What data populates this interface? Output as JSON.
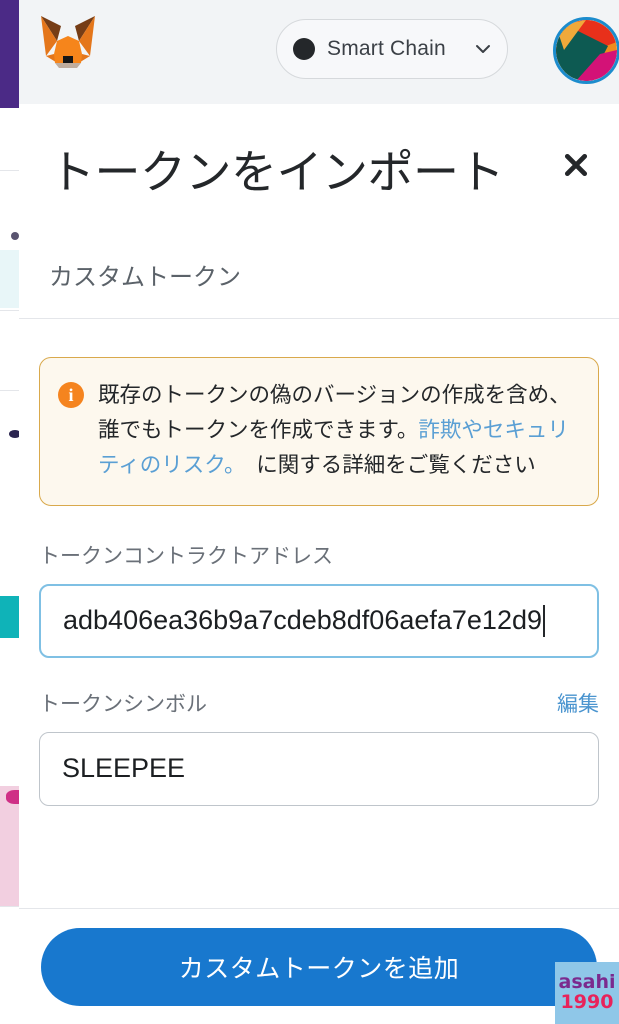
{
  "header": {
    "wallet_logo": "metamask-fox-logo",
    "network": {
      "name": "Smart Chain",
      "dot_color": "#24272a",
      "chevron": "chevron-down-icon"
    },
    "account_avatar": "account-jazzicon-avatar"
  },
  "modal": {
    "title": "トークンをインポート",
    "close_label": "×",
    "tab_label": "カスタムトークン"
  },
  "warning": {
    "icon": "info-icon",
    "text_before": "既存のトークンの偽のバージョンの作成を含め、誰でもトークンを作成できます。",
    "link_text": "詐欺やセキュリティのリスク。",
    "text_after": "　に関する詳細をご覧ください",
    "border_color": "#d9a94c",
    "background_color": "#fdf8ee",
    "icon_color": "#f5841f",
    "link_color": "#5a9fd4"
  },
  "form": {
    "address": {
      "label": "トークンコントラクトアドレス",
      "value": "adb406ea36b9a7cdeb8df06aefa7e12d9",
      "placeholder": "0x...",
      "focused": true,
      "focus_border_color": "#7fc0e4"
    },
    "symbol": {
      "label": "トークンシンボル",
      "action_label": "編集",
      "value": "SLEEPEE",
      "placeholder": ""
    }
  },
  "footer": {
    "submit_label": "カスタムトークンを追加",
    "submit_color": "#1878ce"
  },
  "watermark": {
    "line1": "asahi",
    "line2": "1990",
    "line1_color": "#7b2a8e",
    "line2_color": "#e8235a",
    "background": "#8fc7e8"
  }
}
